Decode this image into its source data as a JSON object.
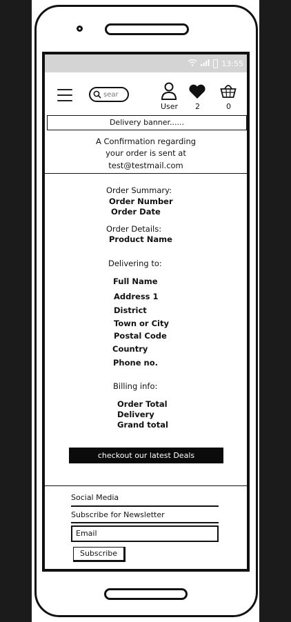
{
  "status_bar": {
    "time": "13:55"
  },
  "header": {
    "search_placeholder": "sear",
    "user_label": "User",
    "wishlist_count": "2",
    "basket_count": "0"
  },
  "banner": {
    "text": "Delivery banner......"
  },
  "confirmation": {
    "line1": "A Confirmation regarding",
    "line2": "your order is sent at",
    "email": "test@testmail.com"
  },
  "summary": {
    "heading": "Order Summary:",
    "order_number": "Order Number",
    "order_date": "Order Date",
    "details_heading": "Order Details:",
    "product_name": "Product Name"
  },
  "delivery": {
    "heading": "Delivering to:",
    "full_name": "Full Name",
    "address1": "Address 1",
    "district": "District",
    "town": "Town or City",
    "postal_code": "Postal Code",
    "country": "Country",
    "phone": "Phone no."
  },
  "billing": {
    "heading": "Billing info:",
    "order_total": "Order Total",
    "delivery": "Delivery",
    "grand_total": "Grand total"
  },
  "deals_button": "checkout our latest Deals",
  "footer": {
    "social": "Social Media",
    "newsletter": "Subscribe for Newsletter",
    "email_placeholder": "Email",
    "subscribe": "Subscribe"
  }
}
